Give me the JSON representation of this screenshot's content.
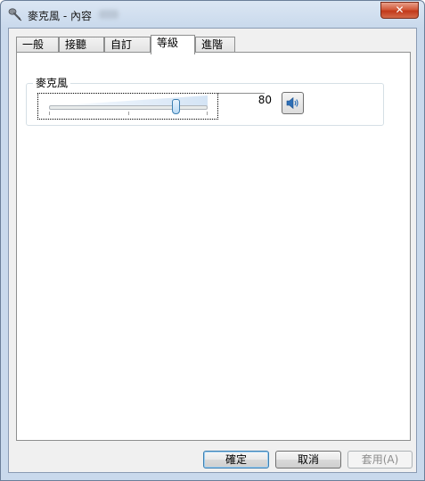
{
  "window": {
    "title": "麥克風 - 內容",
    "close_label": "✕"
  },
  "tabs": [
    {
      "label": "一般",
      "active": false
    },
    {
      "label": "接聽",
      "active": false
    },
    {
      "label": "自訂",
      "active": false
    },
    {
      "label": "等級",
      "active": true
    },
    {
      "label": "進階",
      "active": false
    }
  ],
  "levels": {
    "group_label": "麥克風",
    "value": "80",
    "slider_fraction": 0.8,
    "mute_icon": "speaker-icon"
  },
  "buttons": {
    "ok": "確定",
    "cancel": "取消",
    "apply": "套用(A)"
  }
}
